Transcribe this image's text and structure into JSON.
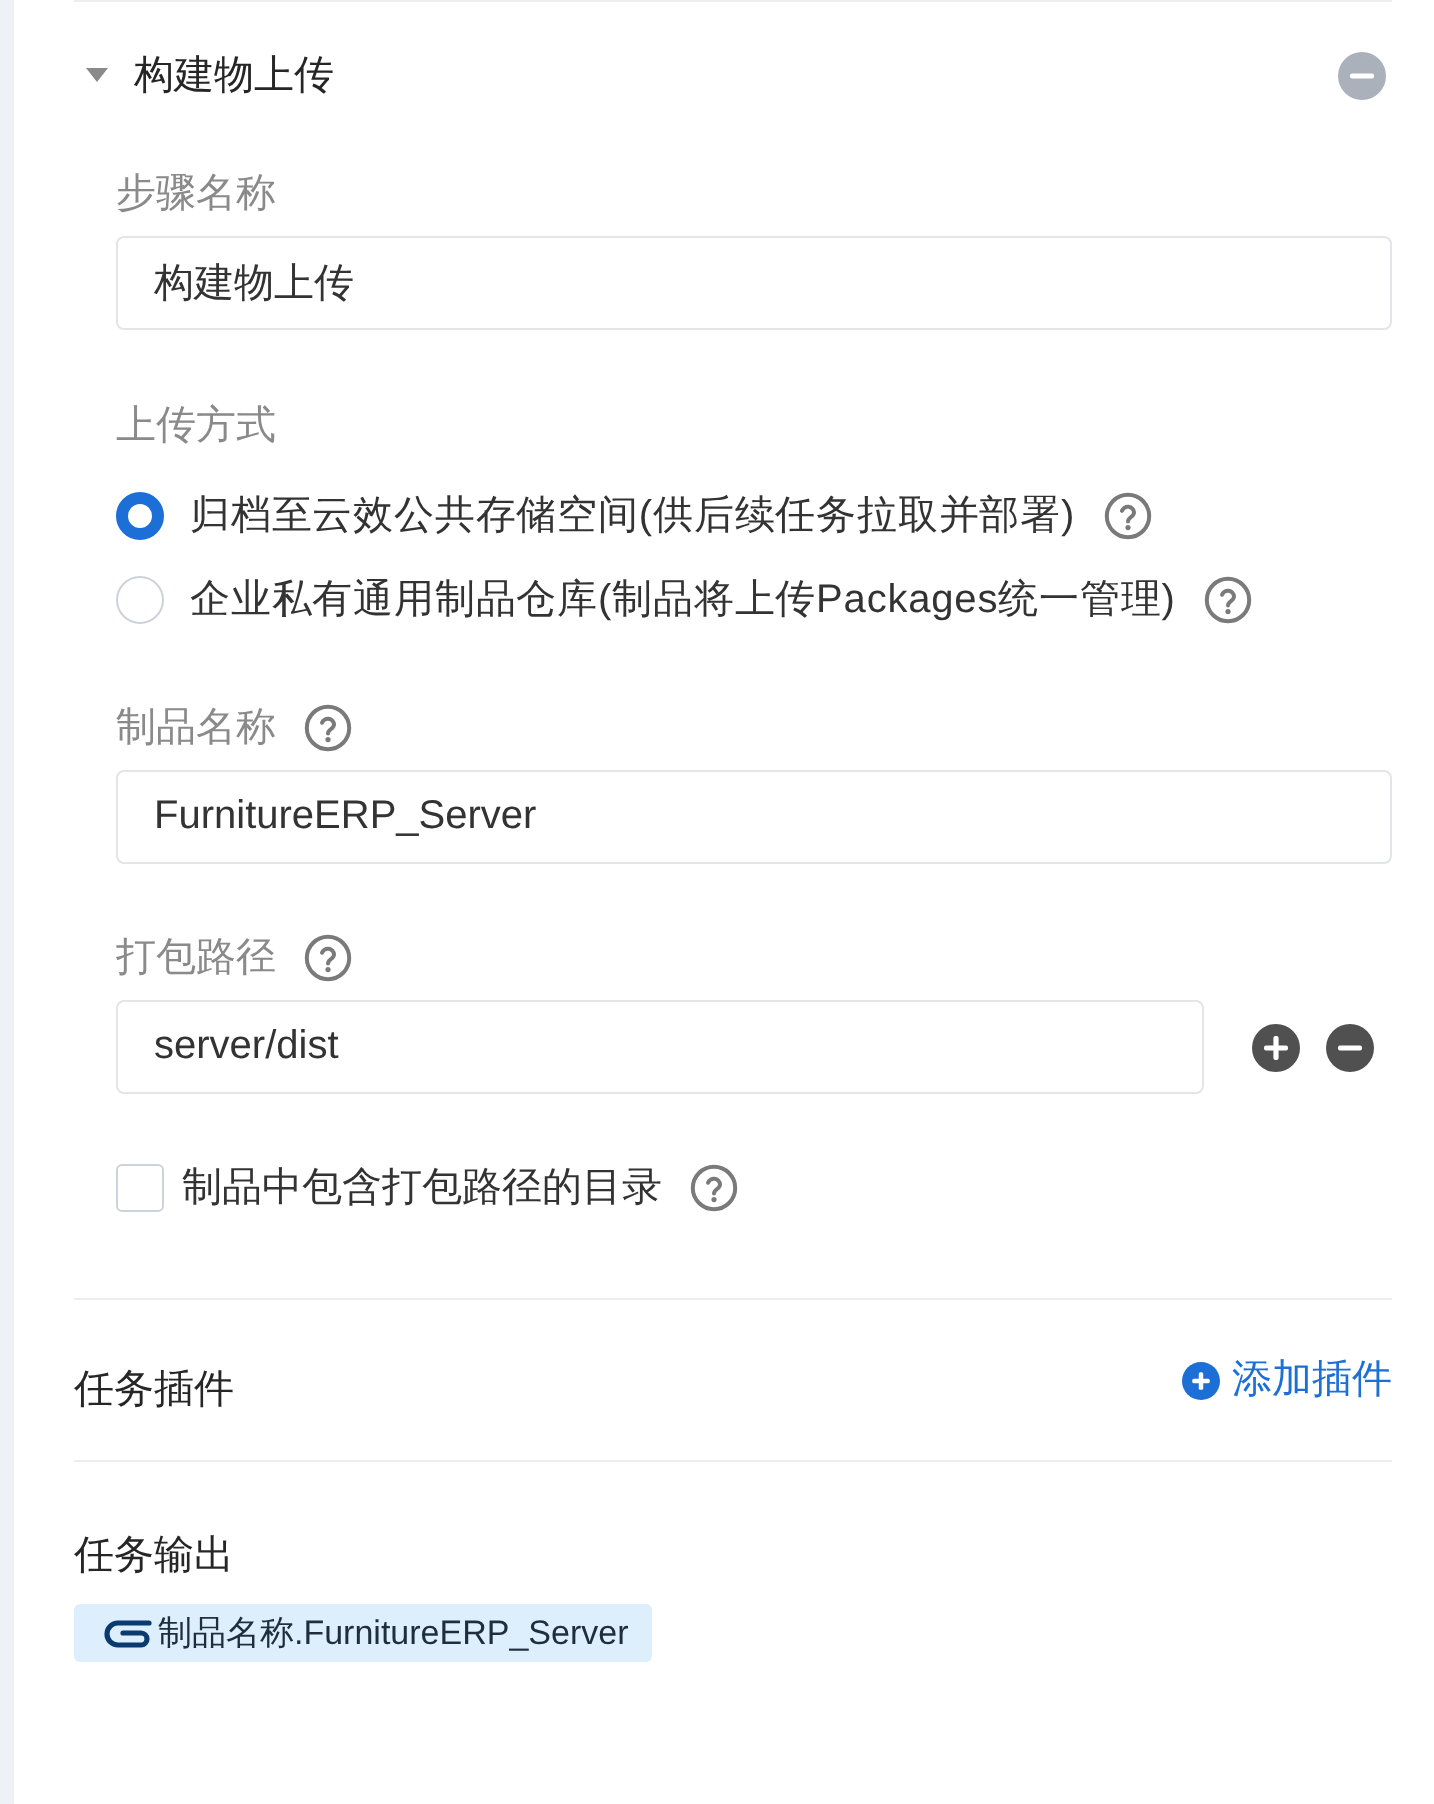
{
  "section": {
    "title": "构建物上传",
    "expanded": true
  },
  "step_name": {
    "label": "步骤名称",
    "value": "构建物上传"
  },
  "upload_method": {
    "label": "上传方式",
    "options": [
      {
        "label": "归档至云效公共存储空间(供后续任务拉取并部署)",
        "selected": true
      },
      {
        "label": "企业私有通用制品仓库(制品将上传Packages统一管理)",
        "selected": false
      }
    ]
  },
  "artifact_name": {
    "label": "制品名称",
    "value": "FurnitureERP_Server"
  },
  "package_paths": {
    "label": "打包路径",
    "paths": [
      {
        "value": "server/dist"
      }
    ]
  },
  "include_dir": {
    "label": "制品中包含打包路径的目录",
    "checked": false
  },
  "plugins": {
    "title": "任务插件",
    "add_link": "添加插件"
  },
  "outputs": {
    "title": "任务输出",
    "tags": [
      "制品名称.FurnitureERP_Server"
    ]
  }
}
